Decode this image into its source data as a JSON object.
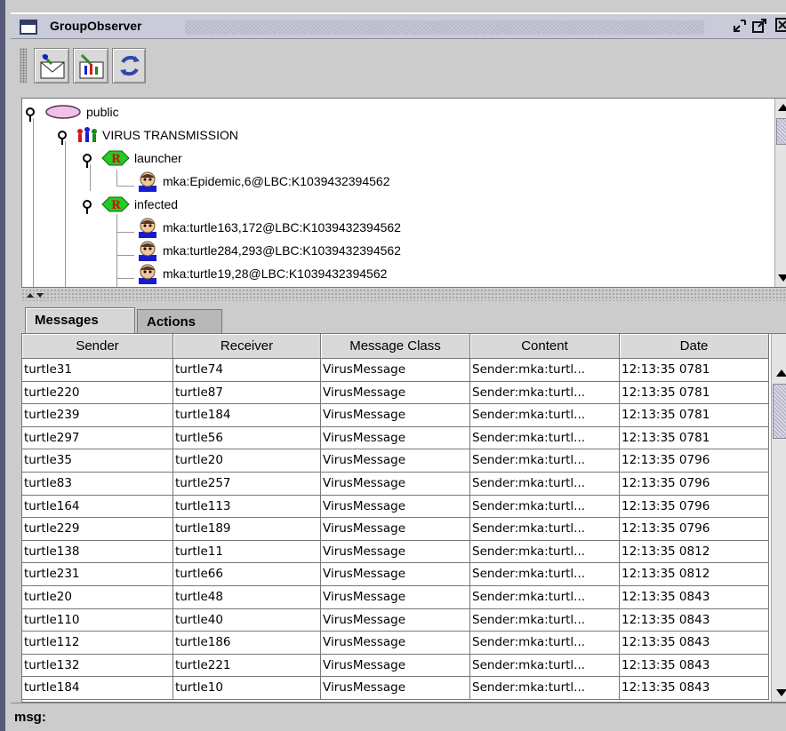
{
  "window": {
    "title": "GroupObserver"
  },
  "tree": {
    "nodes": {
      "community": "public",
      "group": "VIRUS TRANSMISSION",
      "role1": "launcher",
      "agent1": "mka:Epidemic,6@LBC:K1039432394562",
      "role2": "infected",
      "agent2": "mka:turtle163,172@LBC:K1039432394562",
      "agent3": "mka:turtle284,293@LBC:K1039432394562",
      "agent4": "mka:turtle19,28@LBC:K1039432394562"
    }
  },
  "tabs": [
    {
      "label": "Messages",
      "active": true
    },
    {
      "label": "Actions",
      "active": false
    }
  ],
  "table": {
    "columns": [
      "Sender",
      "Receiver",
      "Message Class",
      "Content",
      "Date"
    ],
    "rows": [
      [
        "turtle31",
        "turtle74",
        "VirusMessage",
        "Sender:mka:turtl...",
        "12:13:35 0781"
      ],
      [
        "turtle220",
        "turtle87",
        "VirusMessage",
        "Sender:mka:turtl...",
        "12:13:35 0781"
      ],
      [
        "turtle239",
        "turtle184",
        "VirusMessage",
        "Sender:mka:turtl...",
        "12:13:35 0781"
      ],
      [
        "turtle297",
        "turtle56",
        "VirusMessage",
        "Sender:mka:turtl...",
        "12:13:35 0781"
      ],
      [
        "turtle35",
        "turtle20",
        "VirusMessage",
        "Sender:mka:turtl...",
        "12:13:35 0796"
      ],
      [
        "turtle83",
        "turtle257",
        "VirusMessage",
        "Sender:mka:turtl...",
        "12:13:35 0796"
      ],
      [
        "turtle164",
        "turtle113",
        "VirusMessage",
        "Sender:mka:turtl...",
        "12:13:35 0796"
      ],
      [
        "turtle229",
        "turtle189",
        "VirusMessage",
        "Sender:mka:turtl...",
        "12:13:35 0796"
      ],
      [
        "turtle138",
        "turtle11",
        "VirusMessage",
        "Sender:mka:turtl...",
        "12:13:35 0812"
      ],
      [
        "turtle231",
        "turtle66",
        "VirusMessage",
        "Sender:mka:turtl...",
        "12:13:35 0812"
      ],
      [
        "turtle20",
        "turtle48",
        "VirusMessage",
        "Sender:mka:turtl...",
        "12:13:35 0843"
      ],
      [
        "turtle110",
        "turtle40",
        "VirusMessage",
        "Sender:mka:turtl...",
        "12:13:35 0843"
      ],
      [
        "turtle112",
        "turtle186",
        "VirusMessage",
        "Sender:mka:turtl...",
        "12:13:35 0843"
      ],
      [
        "turtle132",
        "turtle221",
        "VirusMessage",
        "Sender:mka:turtl...",
        "12:13:35 0843"
      ],
      [
        "turtle184",
        "turtle10",
        "VirusMessage",
        "Sender:mka:turtl...",
        "12:13:35 0843"
      ]
    ]
  },
  "status": {
    "label": "msg:"
  },
  "icons": {
    "window": "window-icon",
    "minimize": "minimize-icon",
    "maximize": "maximize-icon",
    "close": "close-icon",
    "send_message": "send-message-icon",
    "group_edit": "group-edit-icon",
    "refresh": "refresh-icon",
    "community": "community-icon",
    "group": "group-icon",
    "role": "role-icon",
    "agent": "agent-icon"
  },
  "colors": {
    "role_badge": "#22cc22",
    "community": "#f0c0e8",
    "selection": "#ffffff"
  }
}
